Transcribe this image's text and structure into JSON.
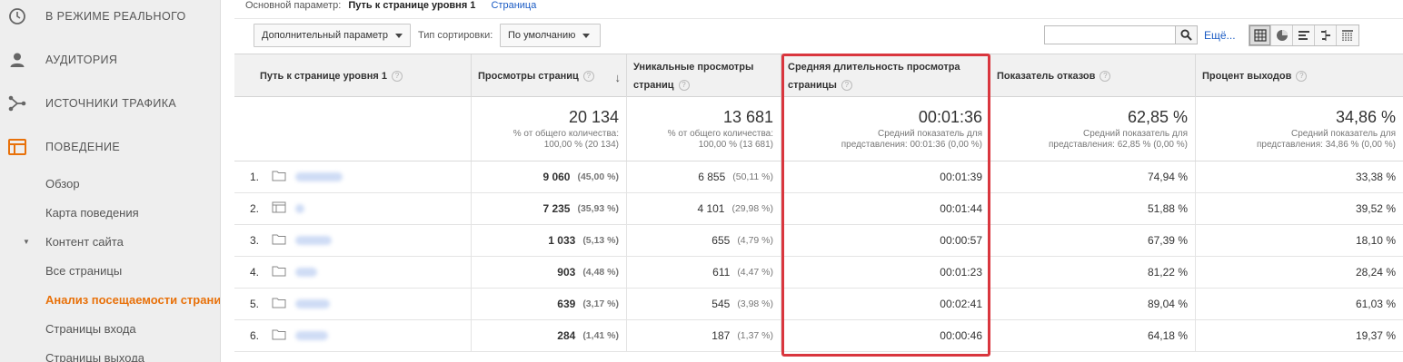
{
  "sidebar": {
    "nav": [
      {
        "label": "В РЕЖИМЕ РЕАЛЬНОГО",
        "icon": "clock-icon"
      },
      {
        "label": "АУДИТОРИЯ",
        "icon": "person-icon"
      },
      {
        "label": "ИСТОЧНИКИ ТРАФИКА",
        "icon": "branch-icon"
      },
      {
        "label": "ПОВЕДЕНИЕ",
        "icon": "layout-icon"
      }
    ],
    "sub": [
      "Обзор",
      "Карта поведения",
      "Контент сайта",
      "Все страницы",
      "Анализ посещаемости страниц",
      "Страницы входа",
      "Страницы выхода"
    ],
    "accent_color": "#e8710a"
  },
  "toolbar": {
    "primary_label": "Основной параметр:",
    "primary_value": "Путь к странице уровня 1",
    "primary_link": "Страница",
    "secondary_dim": "Дополнительный параметр",
    "sort_label": "Тип сортировки:",
    "sort_value": "По умолчанию",
    "more_link": "Ещё..."
  },
  "table": {
    "headers": [
      "Путь к странице уровня 1",
      "Просмотры страниц",
      "Уникальные просмотры страниц",
      "Средняя длительность просмотра страницы",
      "Показатель отказов",
      "Процент выходов"
    ],
    "totals": [
      {
        "value": "20 134",
        "note": "% от общего количества: 100,00 % (20 134)"
      },
      {
        "value": "13 681",
        "note": "% от общего количества: 100,00 % (13 681)"
      },
      {
        "value": "00:01:36",
        "note": "Средний показатель для представления: 00:01:36 (0,00 %)"
      },
      {
        "value": "62,85 %",
        "note": "Средний показатель для представления: 62,85 % (0,00 %)"
      },
      {
        "value": "34,86 %",
        "note": "Средний показатель для представления: 34,86 % (0,00 %)"
      }
    ],
    "rows": [
      {
        "num": "1.",
        "icon": "folder-icon",
        "pv": "9 060",
        "pv_pct": "(45,00 %)",
        "upv": "6 855",
        "upv_pct": "(50,11 %)",
        "avg": "00:01:39",
        "bounce": "74,94 %",
        "exit": "33,38 %"
      },
      {
        "num": "2.",
        "icon": "page-icon",
        "pv": "7 235",
        "pv_pct": "(35,93 %)",
        "upv": "4 101",
        "upv_pct": "(29,98 %)",
        "avg": "00:01:44",
        "bounce": "51,88 %",
        "exit": "39,52 %"
      },
      {
        "num": "3.",
        "icon": "folder-icon",
        "pv": "1 033",
        "pv_pct": "(5,13 %)",
        "upv": "655",
        "upv_pct": "(4,79 %)",
        "avg": "00:00:57",
        "bounce": "67,39 %",
        "exit": "18,10 %"
      },
      {
        "num": "4.",
        "icon": "folder-icon",
        "pv": "903",
        "pv_pct": "(4,48 %)",
        "upv": "611",
        "upv_pct": "(4,47 %)",
        "avg": "00:01:23",
        "bounce": "81,22 %",
        "exit": "28,24 %"
      },
      {
        "num": "5.",
        "icon": "folder-icon",
        "pv": "639",
        "pv_pct": "(3,17 %)",
        "upv": "545",
        "upv_pct": "(3,98 %)",
        "avg": "00:02:41",
        "bounce": "89,04 %",
        "exit": "61,03 %"
      },
      {
        "num": "6.",
        "icon": "folder-icon",
        "pv": "284",
        "pv_pct": "(1,41 %)",
        "upv": "187",
        "upv_pct": "(1,37 %)",
        "avg": "00:00:46",
        "bounce": "64,18 %",
        "exit": "19,37 %"
      }
    ]
  },
  "highlight_color": "#d9363e"
}
